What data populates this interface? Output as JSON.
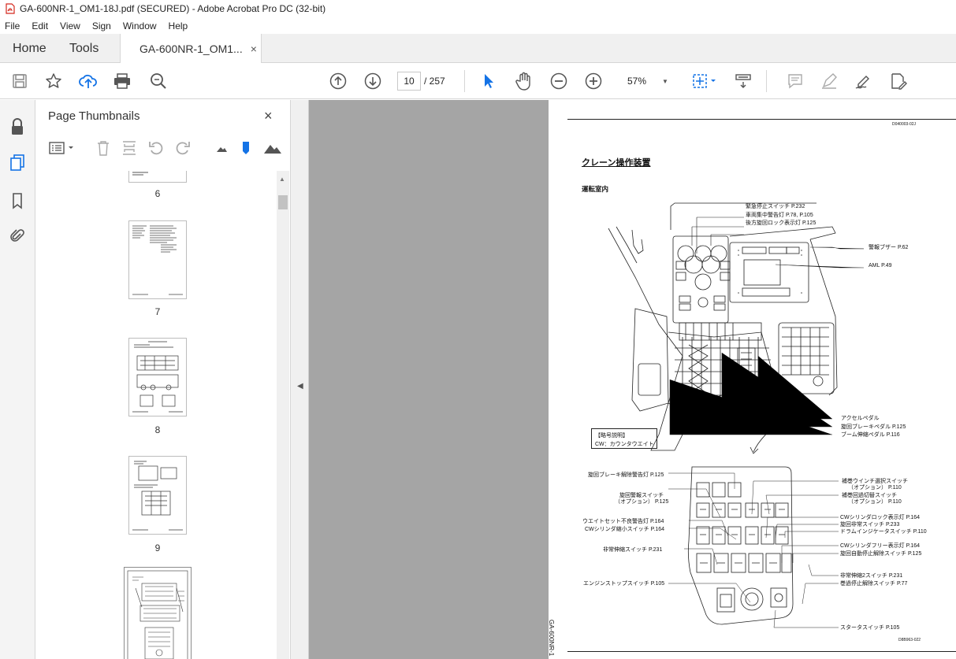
{
  "window": {
    "title": "GA-600NR-1_OM1-18J.pdf (SECURED) - Adobe Acrobat Pro DC (32-bit)"
  },
  "menu": [
    "File",
    "Edit",
    "View",
    "Sign",
    "Window",
    "Help"
  ],
  "tabs": {
    "home": "Home",
    "tools": "Tools",
    "doc": "GA-600NR-1_OM1...",
    "close": "×"
  },
  "toolbar": {
    "page_current": "10",
    "page_total": "/ 257",
    "zoom": "57%"
  },
  "panel": {
    "title": "Page Thumbnails",
    "close": "×"
  },
  "thumbnails": [
    {
      "label": "6"
    },
    {
      "label": "7"
    },
    {
      "label": "8"
    },
    {
      "label": "9"
    }
  ],
  "page": {
    "doc_code": "D040003-02J",
    "heading": "クレーン操作装置",
    "subheading": "運転室内",
    "side_text": "GA-600NR-1_OM1-18J",
    "fig_code": "D8B963-022",
    "legend_title": "【略号説明】",
    "legend_body": "CW：カウンタウエイト",
    "top_labels": [
      "緊急停止スイッチ P.232",
      "車両集中警告灯 P.78, P.105",
      "後方旋回ロック表示灯 P.125",
      "警報ブザー P.62",
      "AML P.49",
      "アクセルペダル",
      "旋回ブレーキペダル P.125",
      "ブーム伸縮ペダル P.116"
    ],
    "left_labels": [
      "旋回ブレーキ解除警告灯 P.125",
      "旋回警報スイッチ",
      "（オプション） P.125",
      "ウエイトセット不良警告灯 P.164",
      "CWシリンダ縮小スイッチ P.164",
      "非常伸縮スイッチ P.231",
      "エンジンストップスイッチ P.105"
    ],
    "right_labels": [
      "補巻ウインチ選択スイッチ",
      "（オプション） P.110",
      "補巻回過切替スイッチ",
      "（オプション） P.110",
      "CWシリンダロック表示灯 P.164",
      "旋回非常スイッチ P.233",
      "ドラムインジケータスイッチ P.110",
      "CWシリンダフリー表示灯 P.164",
      "旋回自動停止解除スイッチ P.125",
      "非常伸縮2スイッチ P.231",
      "巻過停止解除スイッチ P.77",
      "スタータスイッチ P.105"
    ]
  }
}
